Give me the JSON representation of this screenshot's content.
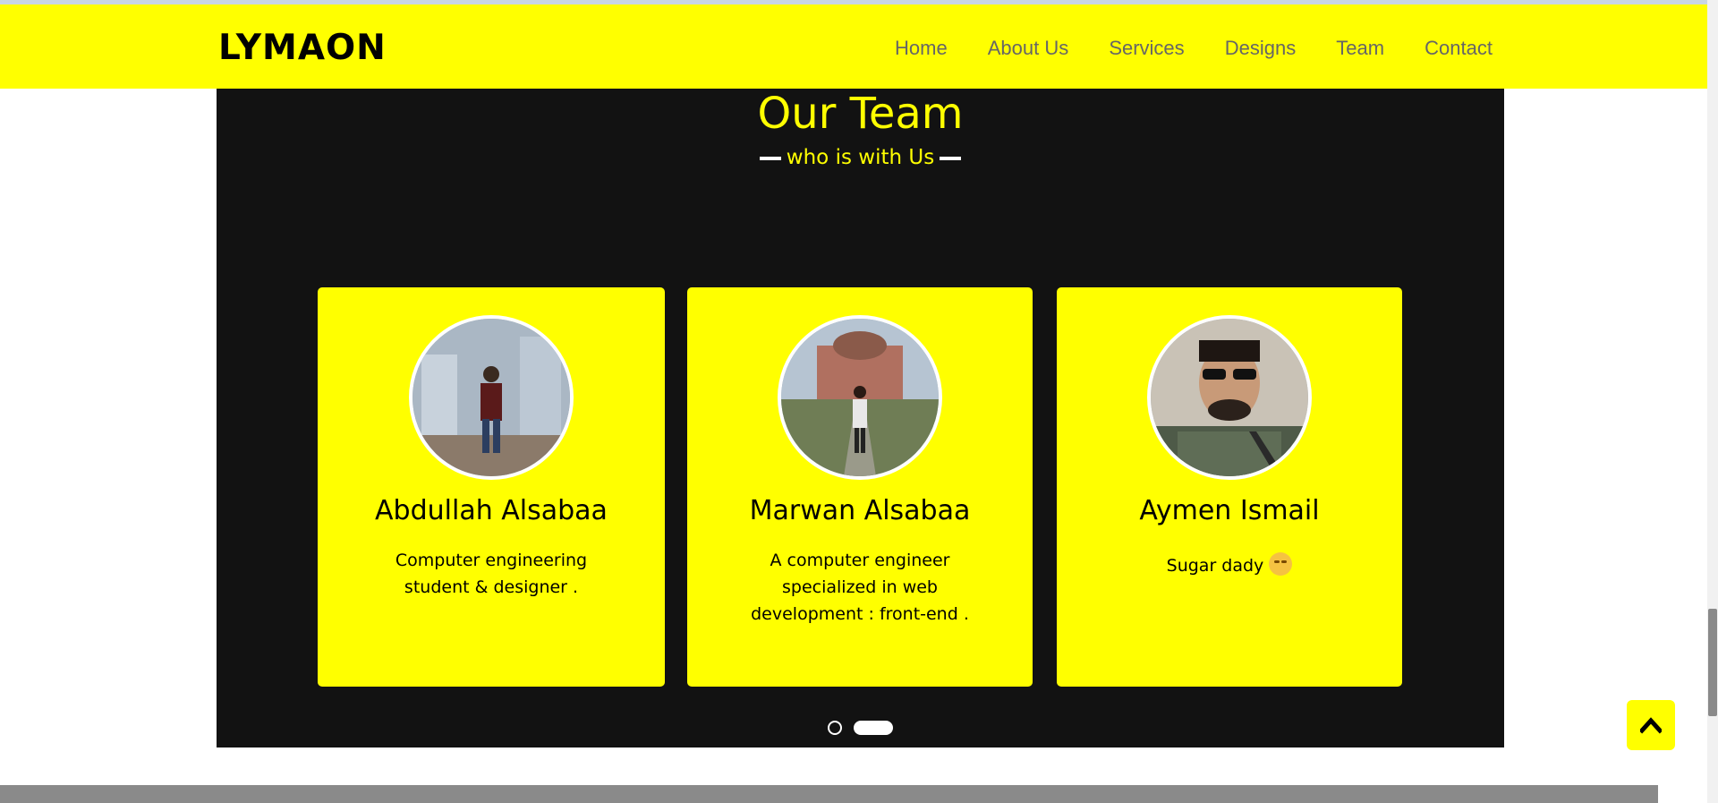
{
  "navbar": {
    "logo": "LYMAON",
    "links": [
      "Home",
      "About Us",
      "Services",
      "Designs",
      "Team",
      "Contact"
    ]
  },
  "team": {
    "title": "Our Team",
    "subtitle": "who is with Us",
    "members": [
      {
        "name": "Abdullah Alsabaa",
        "description": "Computer engineering student & designer ."
      },
      {
        "name": "Marwan Alsabaa",
        "description": "A computer engineer specialized in web development : front-end ."
      },
      {
        "name": "Aymen Ismail",
        "description": "Sugar dady"
      }
    ]
  },
  "colors": {
    "accent": "#ffff00",
    "section_bg": "#121212"
  },
  "icons": {
    "scroll_top": "chevron-up-icon",
    "emoji": "emoji-icon"
  }
}
